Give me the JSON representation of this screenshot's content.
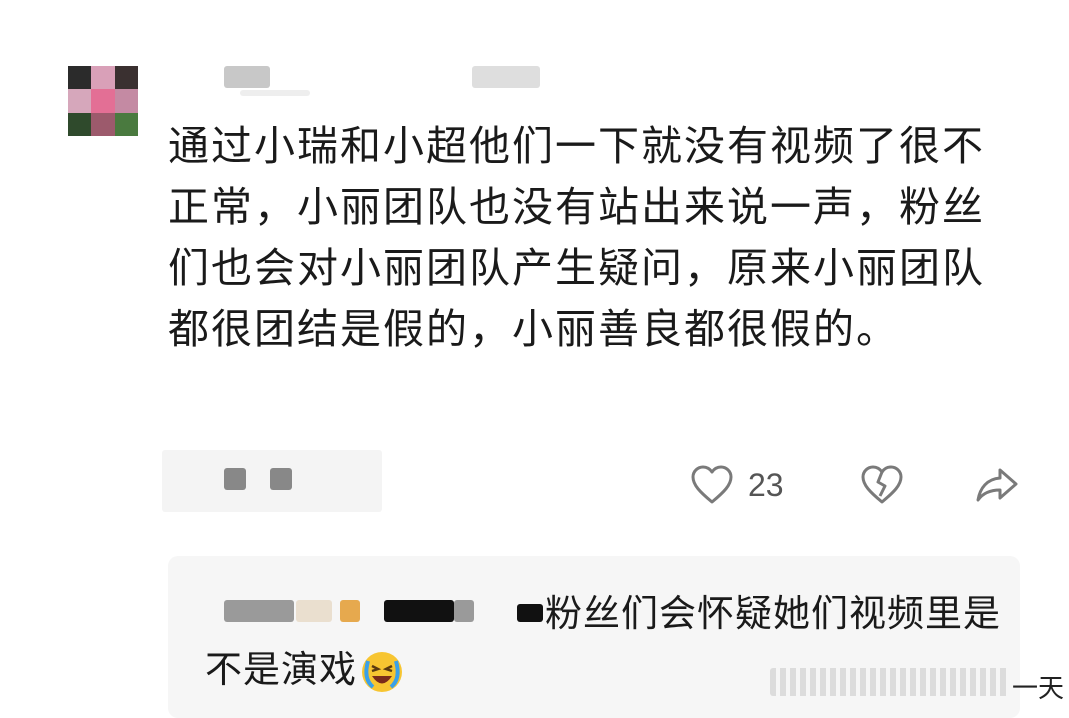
{
  "comment": {
    "text": "通过小瑞和小超他们一下就没有视频了很不正常，小丽团队也没有站出来说一声，粉丝们也会对小丽团队产生疑问，原来小丽团队都很团结是假的，小丽善良都很假的。"
  },
  "actions": {
    "like_icon": "heart-outline-icon",
    "like_count": "23",
    "dislike_icon": "broken-heart-icon",
    "share_icon": "share-arrow-icon"
  },
  "reply": {
    "text": "粉丝们会怀疑她们视频里是不是演戏",
    "emoji_icon": "laughing-crying-emoji-icon",
    "time": "一天"
  },
  "colors": {
    "icon_gray": "#7a7a7a",
    "reply_bg": "#f6f6f6",
    "blur_gray": "#c4c4c4"
  }
}
